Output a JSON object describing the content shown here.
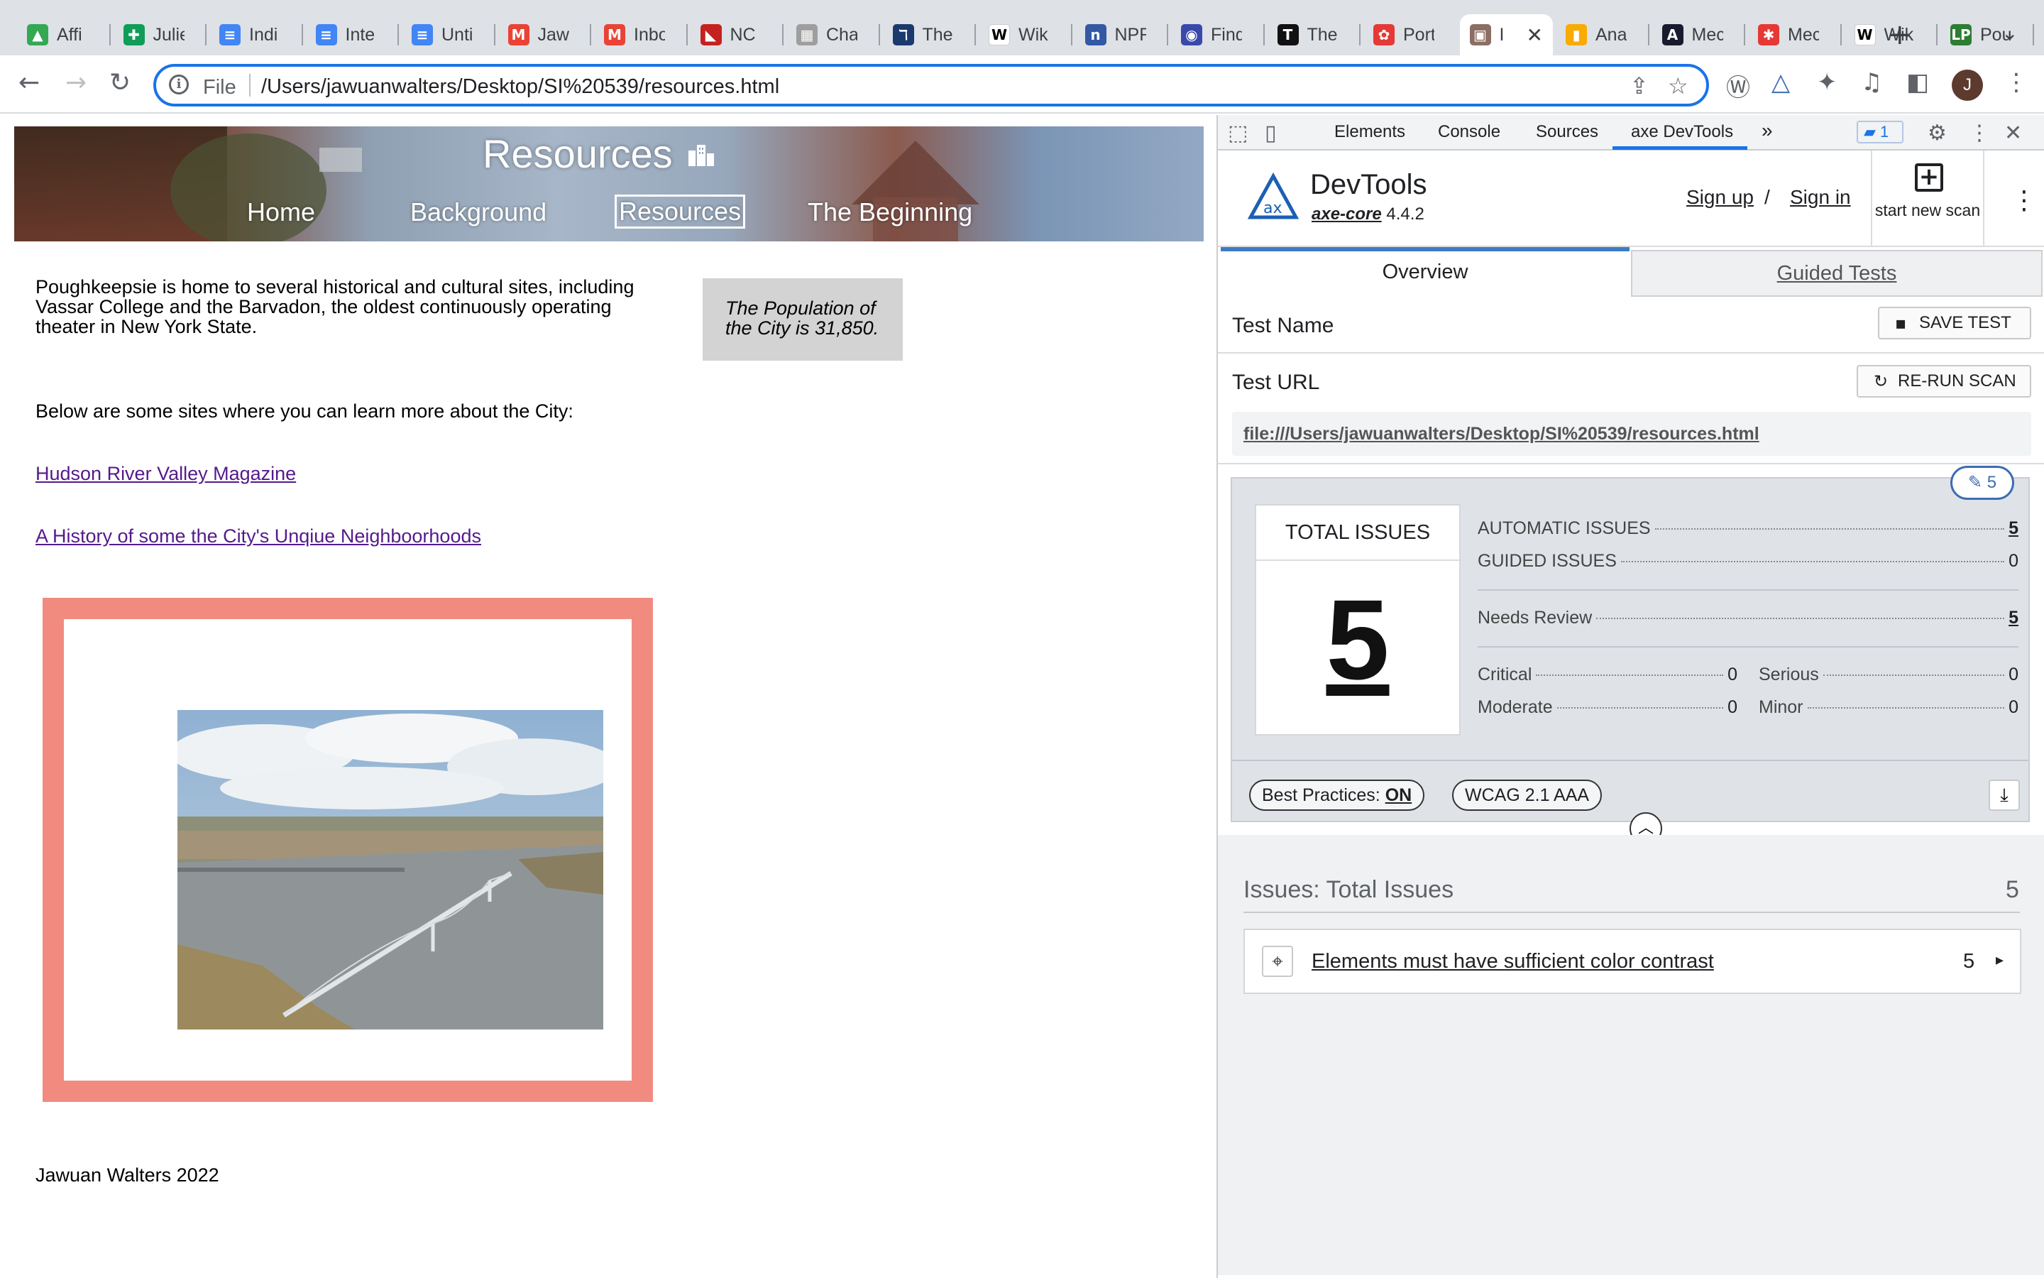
{
  "browser": {
    "tabs": [
      {
        "label": "Affi",
        "icon": "google-drive-icon",
        "color": "#34a853",
        "glyph": "▲"
      },
      {
        "label": "Julie",
        "icon": "google-sheets-icon",
        "color": "#0f9d58",
        "glyph": "✚"
      },
      {
        "label": "Indi",
        "icon": "google-docs-icon",
        "color": "#4285f4",
        "glyph": "≡"
      },
      {
        "label": "Inte",
        "icon": "google-docs-icon",
        "color": "#4285f4",
        "glyph": "≡"
      },
      {
        "label": "Unti",
        "icon": "google-docs-icon",
        "color": "#4285f4",
        "glyph": "≡"
      },
      {
        "label": "Jaw",
        "icon": "gmail-icon",
        "color": "#ea4335",
        "glyph": "M"
      },
      {
        "label": "Inbo",
        "icon": "gmail-icon",
        "color": "#ea4335",
        "glyph": "M"
      },
      {
        "label": "NC",
        "icon": "nc-icon",
        "color": "#c5221f",
        "glyph": "◣"
      },
      {
        "label": "Cha",
        "icon": "chart-icon",
        "color": "#9e9e9e",
        "glyph": "▦"
      },
      {
        "label": "The",
        "icon": "hook-icon",
        "color": "#1a3a6e",
        "glyph": "ℸ"
      },
      {
        "label": "Wik",
        "icon": "wikipedia-icon",
        "color": "#ffffff",
        "glyph": "W"
      },
      {
        "label": "NPR",
        "icon": "npr-icon",
        "color": "#3358a4",
        "glyph": "n"
      },
      {
        "label": "Find",
        "icon": "find-icon",
        "color": "#3949ab",
        "glyph": "◉"
      },
      {
        "label": "The",
        "icon": "nyt-icon",
        "color": "#111111",
        "glyph": "T"
      },
      {
        "label": "Port",
        "icon": "portal-icon",
        "color": "#e53935",
        "glyph": "✿"
      },
      {
        "label": "I",
        "icon": "page-favicon-icon",
        "color": "#8d6e63",
        "glyph": "▣"
      },
      {
        "label": "Ana",
        "icon": "analytics-icon",
        "color": "#f9ab00",
        "glyph": "▮"
      },
      {
        "label": "Mec",
        "icon": "medium-icon",
        "color": "#1a1a2e",
        "glyph": "A"
      },
      {
        "label": "Mec",
        "icon": "asterisk-icon",
        "color": "#e53935",
        "glyph": "✱"
      },
      {
        "label": "Wik",
        "icon": "wikipedia-icon",
        "color": "#ffffff",
        "glyph": "W"
      },
      {
        "label": "Pou",
        "icon": "lp-icon",
        "color": "#2e7d32",
        "glyph": "LP"
      }
    ],
    "active_tab_index": 15,
    "new_tab_symbol": "+",
    "address_prefix": "File",
    "url": "/Users/jawuanwalters/Desktop/SI%20539/resources.html",
    "profile_initial": "J"
  },
  "site": {
    "title": "Resources",
    "nav": [
      "Home",
      "Background",
      "Resources",
      "The Beginning"
    ],
    "intro": "Poughkeepsie is home to several historical and cultural sites, including Vassar College and the Barvadon, the oldest continuously operating theater in New York State.",
    "population_note": "The Population of the City is 31,850.",
    "below_text": "Below are some sites where you can learn more about the City:",
    "links": [
      "Hudson River Valley Magazine",
      "A History of some the City's Unqiue Neighboorhoods"
    ],
    "footer": "Jawuan Walters 2022"
  },
  "devtools": {
    "tabs": [
      "Elements",
      "Console",
      "Sources",
      "axe DevTools"
    ],
    "more_symbol": "»",
    "issues_badge": "1",
    "axe": {
      "product": "DevTools",
      "core_name": "axe-core",
      "core_version": "4.4.2",
      "sign_up": "Sign up",
      "sign_in": "Sign in",
      "auth_separator": "/",
      "new_scan": "start new scan",
      "tab_overview": "Overview",
      "tab_guided": "Guided Tests",
      "test_name_label": "Test Name",
      "save_test": "SAVE TEST",
      "test_url_label": "Test URL",
      "rerun_scan": "RE-RUN SCAN",
      "test_url": "file:///Users/jawuanwalters/Desktop/SI%20539/resources.html",
      "edit_count": "5",
      "total_issues_label": "TOTAL ISSUES",
      "total_issues": "5",
      "automatic_label": "AUTOMATIC ISSUES",
      "automatic": "5",
      "guided_label": "GUIDED ISSUES",
      "guided": "0",
      "needs_review_label": "Needs Review",
      "needs_review": "5",
      "critical_label": "Critical",
      "critical": "0",
      "serious_label": "Serious",
      "serious": "0",
      "moderate_label": "Moderate",
      "moderate": "0",
      "minor_label": "Minor",
      "minor": "0",
      "best_practices_label": "Best Practices:",
      "best_practices_value": "ON",
      "standard": "WCAG 2.1 AAA",
      "issues_title": "Issues: Total Issues",
      "issues_count": "5",
      "issue_rule": "Elements must have sufficient color contrast",
      "issue_rule_count": "5"
    }
  }
}
